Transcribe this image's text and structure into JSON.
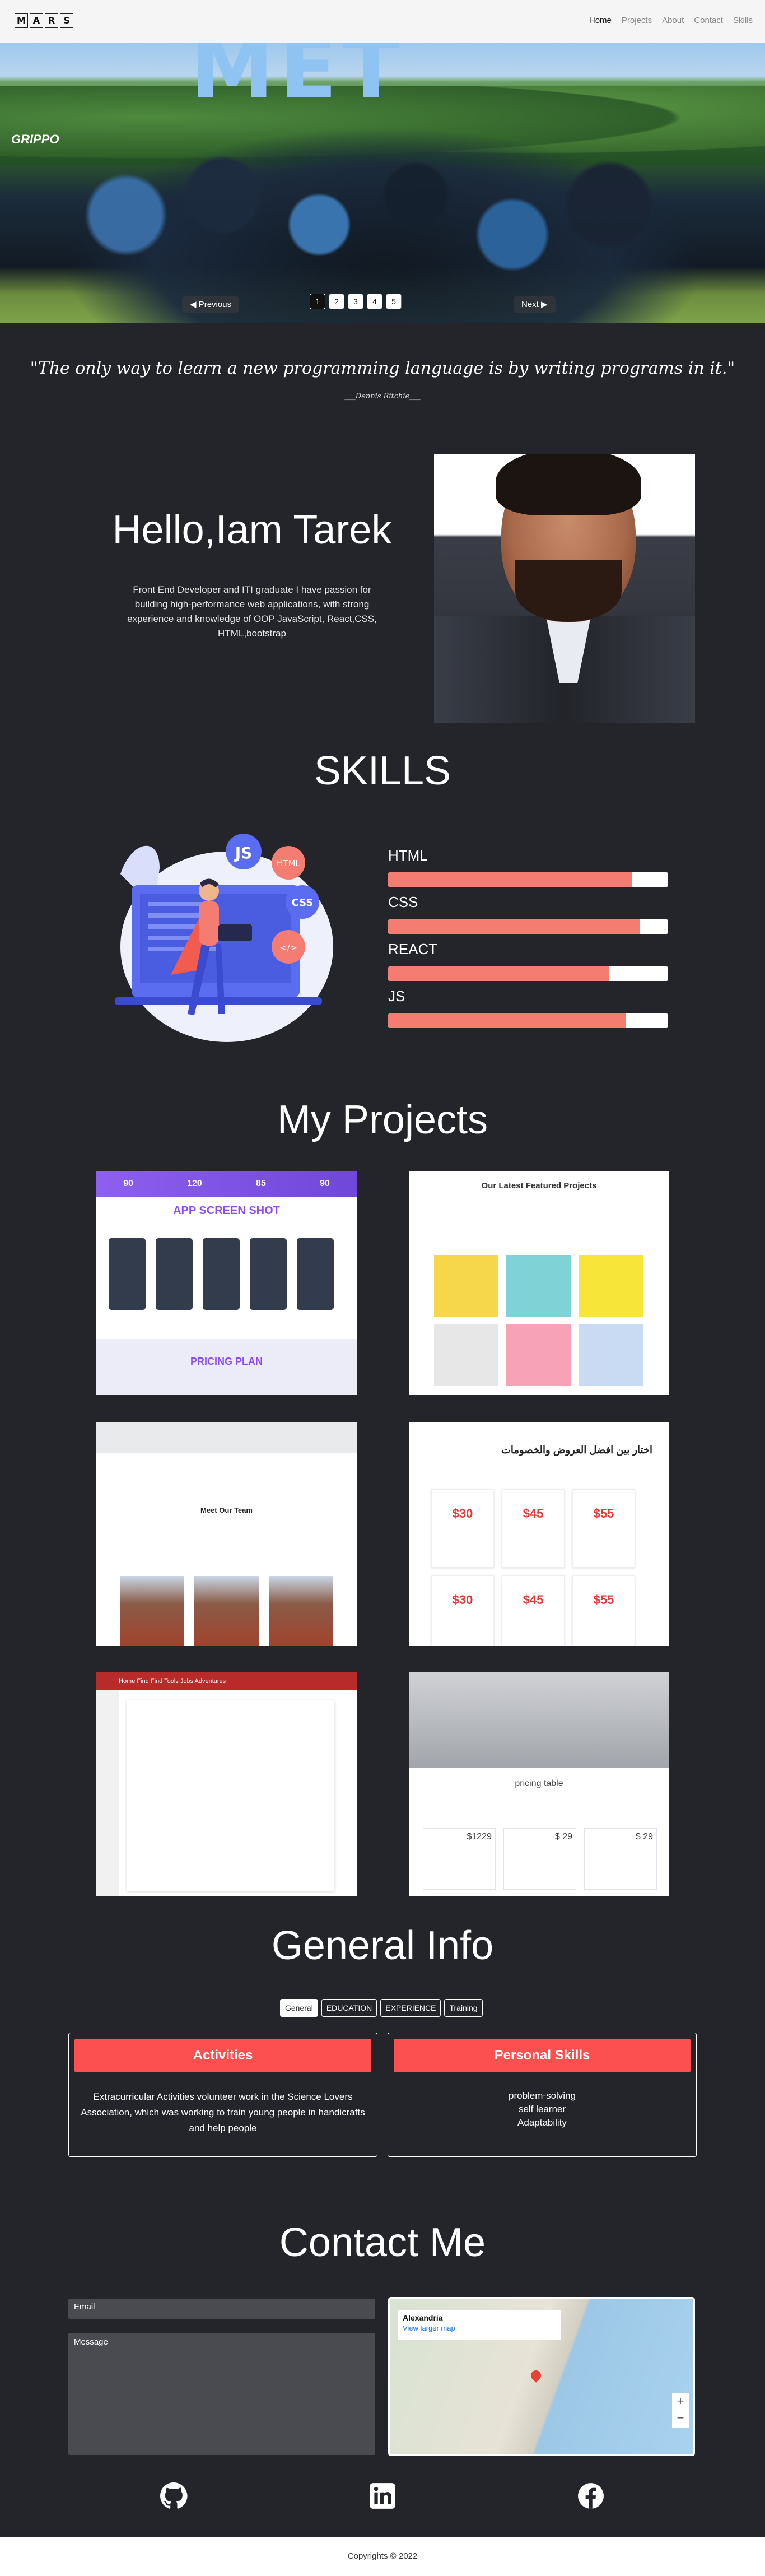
{
  "nav": {
    "logo_letters": [
      "M",
      "A",
      "R",
      "S"
    ],
    "links": [
      {
        "label": "Home",
        "active": true
      },
      {
        "label": "Projects",
        "active": false
      },
      {
        "label": "About",
        "active": false
      },
      {
        "label": "Contact",
        "active": false
      },
      {
        "label": "Skills",
        "active": false
      }
    ]
  },
  "carousel": {
    "brand": "GRIPPO",
    "prev_label": "Previous",
    "next_label": "Next",
    "pages": [
      "1",
      "2",
      "3",
      "4",
      "5"
    ],
    "current_page": "1"
  },
  "quote": {
    "text": "\"The only way to learn a new programming language is by writing programs in it.\"",
    "author": "___Dennis Ritchie___"
  },
  "about": {
    "heading": "Hello,Iam Tarek",
    "description": "Front End Developer and ITI graduate I have passion for building high-performance web applications, with strong experience and knowledge of OOP JavaScript, React,CSS, HTML,bootstrap"
  },
  "skills": {
    "title": "SKILLS",
    "art_badges": [
      "JS",
      "HTML",
      "CSS",
      "</>"
    ],
    "items": [
      {
        "label": "HTML",
        "level": 0.87
      },
      {
        "label": "CSS",
        "level": 0.9
      },
      {
        "label": "REACT",
        "level": 0.79
      },
      {
        "label": "JS",
        "level": 0.85
      }
    ]
  },
  "projects": {
    "title": "My Projects",
    "p1": {
      "stats": [
        "90",
        "120",
        "85",
        "90"
      ],
      "heading": "APP SCREEN SHOT",
      "pricing": "PRICING PLAN"
    },
    "p2": {
      "heading": "Our Latest Featured Projects"
    },
    "p3": {
      "heading": "Meet Our Team"
    },
    "p4": {
      "heading": "اختار بين افضل العروض والخصومات",
      "prices": [
        "$30",
        "$45",
        "$55",
        "$30",
        "$45",
        "$55"
      ]
    },
    "p5": {
      "menu": "Home  Find Find  Tools  Jobs  Adventures"
    },
    "p6": {
      "heading": "pricing table",
      "prices": [
        "$1229",
        "$ 29",
        "$ 29"
      ]
    }
  },
  "general_info": {
    "title": "General Info",
    "tabs": [
      {
        "label": "General",
        "active": true
      },
      {
        "label": "EDUCATION",
        "active": false
      },
      {
        "label": "EXPERIENCE",
        "active": false
      },
      {
        "label": "Training",
        "active": false
      }
    ],
    "activities": {
      "heading": "Activities",
      "text": "Extracurricular Activities volunteer work in the Science Lovers Association, which was working to train young people in handicrafts and help people"
    },
    "personal_skills": {
      "heading": "Personal Skills",
      "items": [
        "problem-solving",
        "self learner",
        "Adaptability"
      ]
    }
  },
  "contact": {
    "title": "Contact Me",
    "email_placeholder": "Email",
    "message_placeholder": "Message",
    "map": {
      "place": "Alexandria",
      "link": "View larger map",
      "plus": "+",
      "minus": "−"
    }
  },
  "social": [
    "github-icon",
    "linkedin-icon",
    "facebook-icon"
  ],
  "footer": {
    "text": "Copyrights © 2022"
  }
}
